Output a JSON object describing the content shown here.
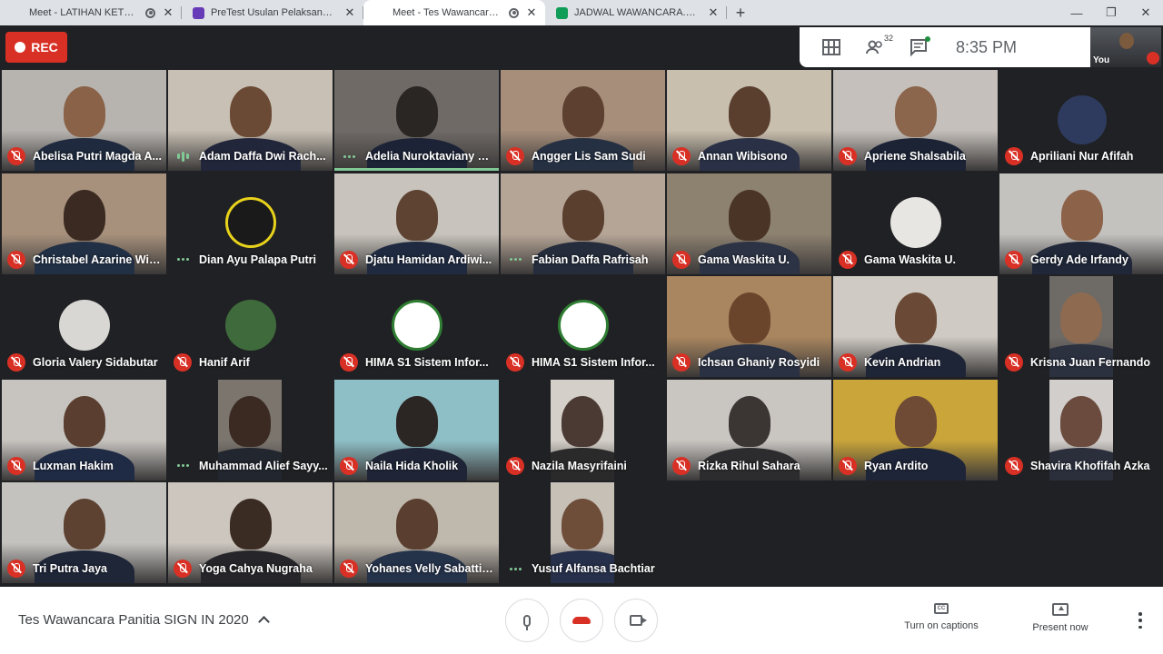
{
  "browser": {
    "tabs": [
      {
        "title": "Meet - LATIHAN KETERAMPI",
        "favicon": "meet-icon",
        "recording": true,
        "active": false
      },
      {
        "title": "PreTest Usulan Pelaksanaan kegia",
        "favicon": "forms-icon",
        "recording": false,
        "active": false
      },
      {
        "title": "Meet - Tes Wawancara Panitia",
        "favicon": "meet-icon",
        "recording": true,
        "active": true
      },
      {
        "title": "JADWAL WAWANCARA.xlsx - Goo",
        "favicon": "sheets-icon",
        "recording": false,
        "active": false
      }
    ],
    "new_tab_label": "+",
    "window_controls": [
      "—",
      "❐",
      "✕"
    ]
  },
  "meet": {
    "rec_label": "REC",
    "participant_count": "32",
    "time": "8:35  PM",
    "self_label": "You",
    "meeting_title": "Tes Wawancara Panitia SIGN IN 2020",
    "captions_label": "Turn on captions",
    "present_label": "Present now"
  },
  "participants": [
    {
      "name": "Abelisa Putri Magda A...",
      "status": "muted",
      "bg": "#b7b4b0",
      "skin": "#8a6247",
      "shirt": "#1f2a3e"
    },
    {
      "name": "Adam Daffa Dwi Rach...",
      "status": "speaking",
      "bg": "#c8c0b4",
      "skin": "#6b4a35",
      "shirt": "#22263a"
    },
    {
      "name": "Adelia Nuroktaviany W...",
      "status": "talking",
      "bg": "#6f6a66",
      "skin": "#2a2624",
      "shirt": "#1d2336",
      "highlight": true
    },
    {
      "name": "Angger Lis Sam Sudi",
      "status": "muted",
      "bg": "#a68e7b",
      "skin": "#5d4030",
      "shirt": "#253042"
    },
    {
      "name": "Annan Wibisono",
      "status": "muted",
      "bg": "#c9bfae",
      "skin": "#5a3f2f",
      "shirt": "#2a3146"
    },
    {
      "name": "Apriene Shalsabila",
      "status": "muted",
      "bg": "#c5c0bb",
      "skin": "#8b654c",
      "shirt": "#1c2335"
    },
    {
      "name": "Apriliani Nur Afifah",
      "status": "muted",
      "bg": "#202124",
      "avatar": "#2e3b5e",
      "avatar_size": "small"
    },
    {
      "name": "Christabel Azarine Wib...",
      "status": "muted",
      "bg": "#a7917c",
      "skin": "#3a2a22",
      "shirt": "#223046"
    },
    {
      "name": "Dian Ayu Palapa Putri",
      "status": "talking",
      "bg": "#202124",
      "avatar": "#1a1a1a",
      "avatar_ring": "#e8d21b"
    },
    {
      "name": "Djatu Hamidan Ardiwi...",
      "status": "muted",
      "bg": "#c8c4bd",
      "skin": "#5e4332",
      "shirt": "#1f2a40"
    },
    {
      "name": "Fabian Daffa Rafrisah",
      "status": "talking",
      "bg": "#b5a596",
      "skin": "#5a3e2e",
      "shirt": "#252c3b"
    },
    {
      "name": "Gama Waskita U.",
      "status": "muted",
      "bg": "#8d8170",
      "skin": "#4a3426",
      "shirt": "#2c3344"
    },
    {
      "name": "Gama Waskita U.",
      "status": "muted",
      "bg": "#202124",
      "avatar": "#e8e6e2"
    },
    {
      "name": "Gerdy Ade Irfandy",
      "status": "muted",
      "bg": "#c4c2bf",
      "skin": "#8c6248",
      "shirt": "#1f2738"
    },
    {
      "name": "Gloria Valery Sidabutar",
      "status": "muted",
      "bg": "#202124",
      "avatar": "#d9d7d3"
    },
    {
      "name": "Hanif Arif",
      "status": "muted",
      "bg": "#202124",
      "avatar": "#3f6b3c"
    },
    {
      "name": "HIMA S1 Sistem Infor...",
      "status": "muted",
      "bg": "#202124",
      "avatar": "#ffffff",
      "avatar_ring": "#2e7d32"
    },
    {
      "name": "HIMA S1 Sistem Infor...",
      "status": "muted",
      "bg": "#202124",
      "avatar": "#ffffff",
      "avatar_ring": "#2e7d32"
    },
    {
      "name": "Ichsan Ghaniy Rosyidi",
      "status": "muted",
      "bg": "#a9865f",
      "skin": "#6a452c",
      "shirt": "#2a3142"
    },
    {
      "name": "Kevin Andrian",
      "status": "muted",
      "bg": "#cfcac3",
      "skin": "#6a4a36",
      "shirt": "#1e2537"
    },
    {
      "name": "Krisna Juan Fernando",
      "status": "muted",
      "bg": "#6e6a66",
      "skin": "#8d6a50",
      "shirt": "#2c3140",
      "narrow": true
    },
    {
      "name": "Luxman Hakim",
      "status": "muted",
      "bg": "#c7c4c0",
      "skin": "#5a3f30",
      "shirt": "#1f2a44"
    },
    {
      "name": "Muhammad Alief Sayy...",
      "status": "talking",
      "bg": "#7b756e",
      "skin": "#3a2a22",
      "shirt": "#22262e",
      "narrow": true
    },
    {
      "name": "Naila Hida Kholik",
      "status": "muted",
      "bg": "#8fbfc6",
      "skin": "#2b2523",
      "shirt": "#1f2536"
    },
    {
      "name": "Nazila Masyrifaini",
      "status": "muted",
      "bg": "#d4cfc8",
      "skin": "#4a3a33",
      "shirt": "#2a2a2a",
      "narrow": true
    },
    {
      "name": "Rizka Rihul Sahara",
      "status": "muted",
      "bg": "#c9c6c2",
      "skin": "#3b3533",
      "shirt": "#2c2c2e"
    },
    {
      "name": "Ryan Ardito",
      "status": "muted",
      "bg": "#c9a53a",
      "skin": "#6f4b35",
      "shirt": "#1e2538"
    },
    {
      "name": "Shavira Khofifah Azka",
      "status": "muted",
      "bg": "#d2cecc",
      "skin": "#6a4b3d",
      "shirt": "#2b2f3c",
      "narrow": true
    },
    {
      "name": "Tri Putra Jaya",
      "status": "muted",
      "bg": "#c4c2bf",
      "skin": "#5d4131",
      "shirt": "#1f2638"
    },
    {
      "name": "Yoga Cahya Nugraha",
      "status": "muted",
      "bg": "#ccc6bf",
      "skin": "#3a2b23",
      "shirt": "#26262a"
    },
    {
      "name": "Yohanes Velly Sabattino",
      "status": "muted",
      "bg": "#bfb8ad",
      "skin": "#5a3f30",
      "shirt": "#24324a"
    },
    {
      "name": "Yusuf Alfansa Bachtiar",
      "status": "talking",
      "bg": "#c7c0b7",
      "skin": "#6e4d39",
      "shirt": "#27304a",
      "narrow": true
    }
  ]
}
